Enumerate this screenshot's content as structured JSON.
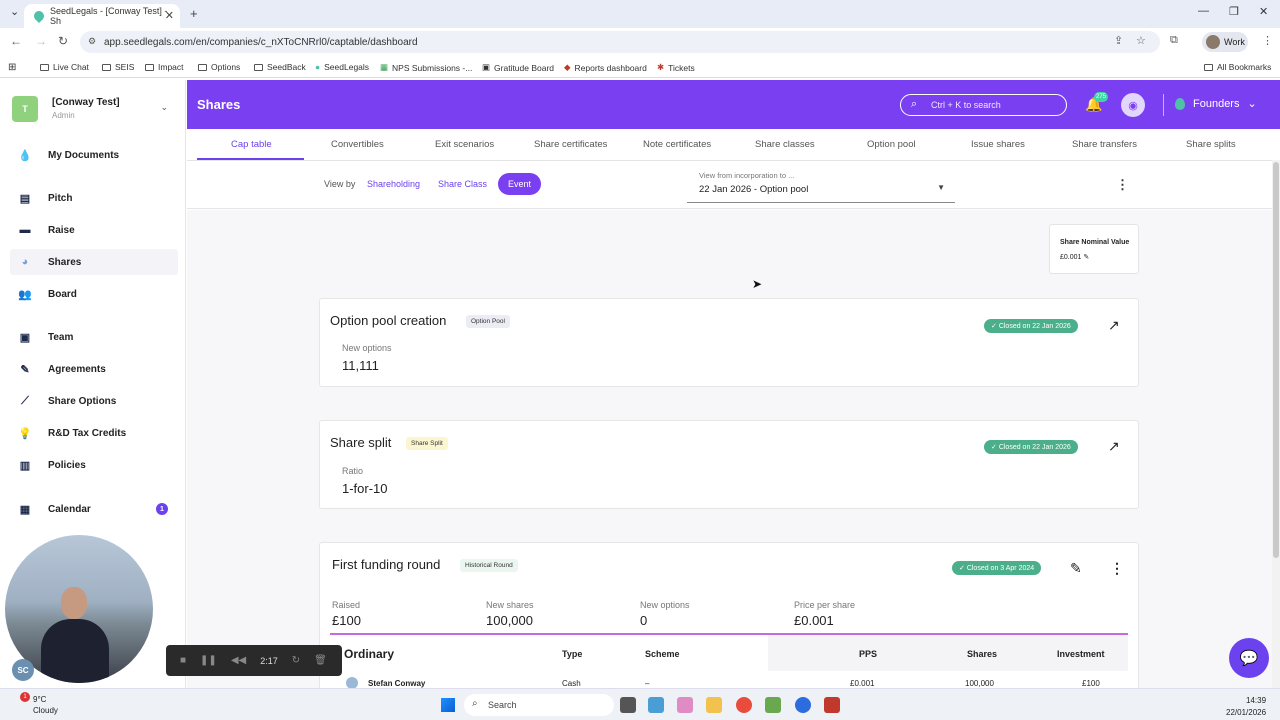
{
  "browser": {
    "tab_title": "SeedLegals - [Conway Test] - Sh",
    "url": "app.seedlegals.com/en/companies/c_nXToCNRrl0/captable/dashboard",
    "profile": "Work",
    "bookmarks": [
      "Live Chat",
      "SEIS",
      "Impact",
      "Options",
      "SeedBack",
      "SeedLegals",
      "NPS Submissions -...",
      "Gratitude Board",
      "Reports dashboard",
      "Tickets"
    ],
    "all_bookmarks": "All Bookmarks"
  },
  "sidebar": {
    "org_logo": "T",
    "org_name": "[Conway Test]",
    "org_role": "Admin",
    "items": [
      {
        "label": "My Documents",
        "icon": "droplet-icon"
      },
      {
        "label": "Pitch",
        "icon": "pitch-icon"
      },
      {
        "label": "Raise",
        "icon": "raise-icon"
      },
      {
        "label": "Shares",
        "icon": "pie-icon"
      },
      {
        "label": "Board",
        "icon": "board-icon"
      },
      {
        "label": "Team",
        "icon": "team-icon"
      },
      {
        "label": "Agreements",
        "icon": "agreements-icon"
      },
      {
        "label": "Share Options",
        "icon": "chart-icon"
      },
      {
        "label": "R&D Tax Credits",
        "icon": "bulb-icon"
      },
      {
        "label": "Policies",
        "icon": "policies-icon"
      },
      {
        "label": "Calendar",
        "icon": "calendar-icon",
        "badge": "1"
      }
    ]
  },
  "header": {
    "title": "Shares",
    "search_placeholder": "Ctrl + K to search",
    "notif_count": "275",
    "account": "Founders"
  },
  "subnav": [
    "Cap table",
    "Convertibles",
    "Exit scenarios",
    "Share certificates",
    "Note certificates",
    "Share classes",
    "Option pool",
    "Issue shares",
    "Share transfers",
    "Share splits"
  ],
  "viewbar": {
    "view_by": "View by",
    "options": [
      "Shareholding",
      "Share Class"
    ],
    "active": "Event",
    "time_label": "View from incorporation to ...",
    "time_value": "22 Jan 2026 - Option pool"
  },
  "nominal": {
    "label": "Share Nominal Value",
    "value": "£0.001"
  },
  "cards": {
    "option_pool": {
      "title": "Option pool creation",
      "tag": "Option Pool",
      "status": "Closed on 22 Jan 2026",
      "field_label": "New options",
      "field_value": "11,111"
    },
    "share_split": {
      "title": "Share split",
      "tag": "Share Split",
      "status": "Closed on 22 Jan 2026",
      "field_label": "Ratio",
      "field_value": "1-for-10"
    },
    "funding": {
      "title": "First funding round",
      "tag": "Historical Round",
      "status": "Closed on 3 Apr 2024",
      "fields": [
        {
          "label": "Raised",
          "value": "£100"
        },
        {
          "label": "New shares",
          "value": "100,000"
        },
        {
          "label": "New options",
          "value": "0"
        },
        {
          "label": "Price per share",
          "value": "£0.001"
        }
      ],
      "table_title": "Ordinary",
      "columns": [
        "Type",
        "Scheme",
        "PPS",
        "Shares",
        "Investment"
      ],
      "row": {
        "name": "Stefan Conway",
        "type": "Cash",
        "scheme": "–",
        "pps": "£0.001",
        "shares": "100,000",
        "investment": "£100"
      }
    }
  },
  "recorder": {
    "time": "2:17"
  },
  "presenter_initials": "SC",
  "taskbar": {
    "temp": "9°C",
    "weather": "Cloudy",
    "weather_badge": "1",
    "search": "Search",
    "time": "14:39",
    "date": "22/01/2026"
  },
  "colors": {
    "brand": "#7b3ff2",
    "success": "#4caf8b"
  }
}
